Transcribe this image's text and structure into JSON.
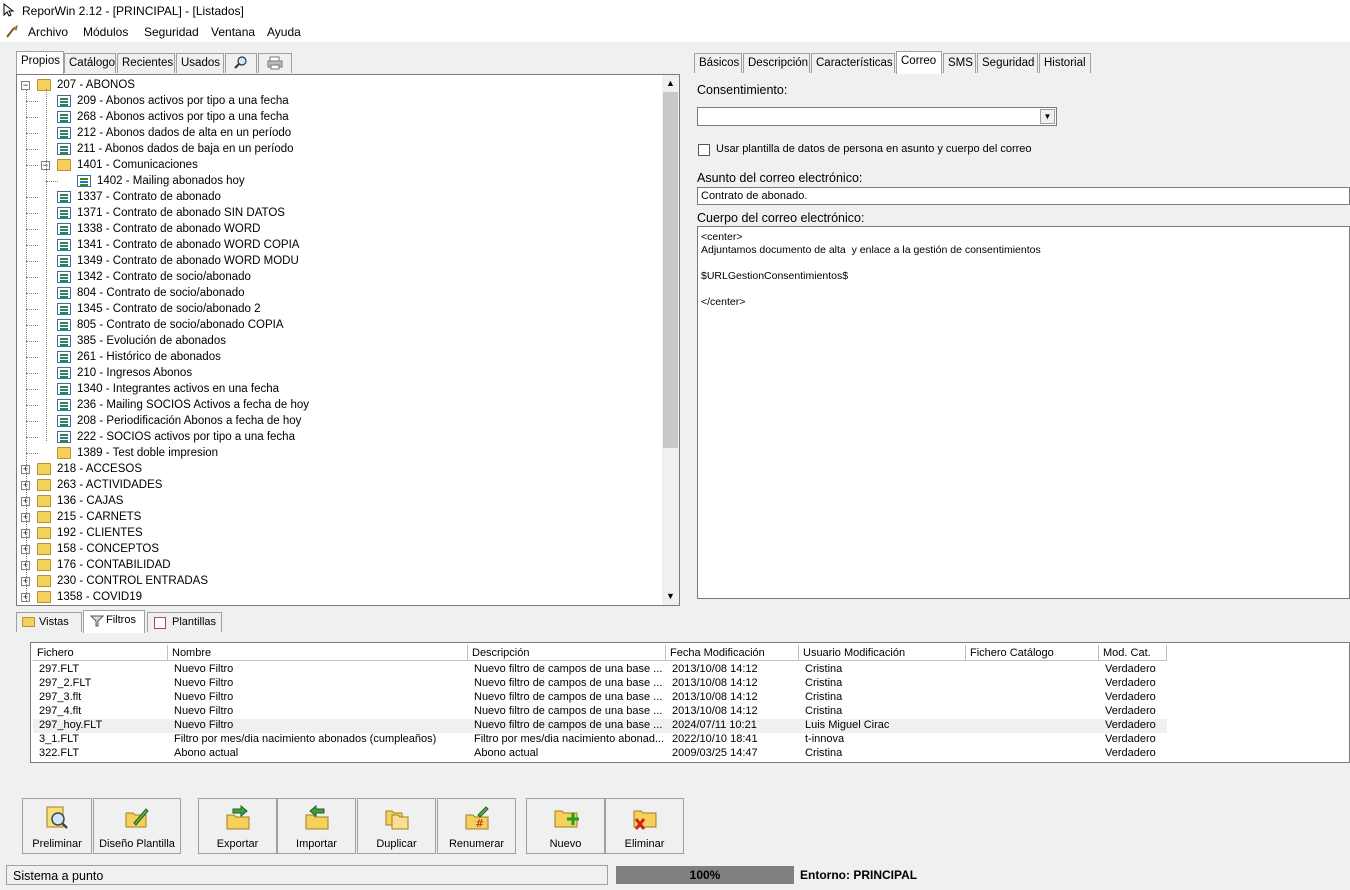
{
  "window": {
    "title": "ReporWin 2.12 - [PRINCIPAL] - [Listados]"
  },
  "menu": [
    "Archivo",
    "Módulos",
    "Seguridad",
    "Ventana",
    "Ayuda"
  ],
  "left_tabs": [
    "Propios",
    "Catálogo",
    "Recientes",
    "Usados"
  ],
  "left_tab_icons": [
    "search-icon",
    "printer-icon"
  ],
  "tree": [
    {
      "label": "207 - ABONOS",
      "level": 0,
      "type": "folder",
      "expanded": true
    },
    {
      "label": "209 - Abonos activos por tipo a una fecha",
      "level": 1,
      "type": "report"
    },
    {
      "label": "268 - Abonos activos por tipo a una fecha",
      "level": 1,
      "type": "report"
    },
    {
      "label": "212 - Abonos dados de alta en un período",
      "level": 1,
      "type": "report"
    },
    {
      "label": "211 - Abonos dados de baja en un período",
      "level": 1,
      "type": "report"
    },
    {
      "label": "1401 - Comunicaciones",
      "level": 1,
      "type": "folder",
      "expanded": true
    },
    {
      "label": "1402 - Mailing abonados hoy",
      "level": 2,
      "type": "report"
    },
    {
      "label": "1337 - Contrato de abonado",
      "level": 1,
      "type": "report"
    },
    {
      "label": "1371 - Contrato de abonado SIN DATOS",
      "level": 1,
      "type": "report"
    },
    {
      "label": "1338 - Contrato de abonado WORD",
      "level": 1,
      "type": "report"
    },
    {
      "label": "1341 - Contrato de abonado WORD COPIA",
      "level": 1,
      "type": "report"
    },
    {
      "label": "1349 - Contrato de abonado WORD MODU",
      "level": 1,
      "type": "report"
    },
    {
      "label": "1342 - Contrato de socio/abonado",
      "level": 1,
      "type": "report"
    },
    {
      "label": "804 - Contrato de socio/abonado",
      "level": 1,
      "type": "report"
    },
    {
      "label": "1345 - Contrato de socio/abonado 2",
      "level": 1,
      "type": "report"
    },
    {
      "label": "805 - Contrato de socio/abonado COPIA",
      "level": 1,
      "type": "report"
    },
    {
      "label": "385 - Evolución de abonados",
      "level": 1,
      "type": "report"
    },
    {
      "label": "261 - Histórico de abonados",
      "level": 1,
      "type": "report"
    },
    {
      "label": "210 - Ingresos Abonos",
      "level": 1,
      "type": "report"
    },
    {
      "label": "1340 - Integrantes activos en una fecha",
      "level": 1,
      "type": "report"
    },
    {
      "label": "236 - Mailing SOCIOS Activos a fecha de hoy",
      "level": 1,
      "type": "report"
    },
    {
      "label": "208 - Periodificación Abonos a fecha de hoy",
      "level": 1,
      "type": "report"
    },
    {
      "label": "222 - SOCIOS activos por tipo a una fecha",
      "level": 1,
      "type": "report"
    },
    {
      "label": "1389 - Test doble impresion",
      "level": 1,
      "type": "folder"
    },
    {
      "label": "218 - ACCESOS",
      "level": 0,
      "type": "folder"
    },
    {
      "label": "263 - ACTIVIDADES",
      "level": 0,
      "type": "folder"
    },
    {
      "label": "136 - CAJAS",
      "level": 0,
      "type": "folder"
    },
    {
      "label": "215 - CARNETS",
      "level": 0,
      "type": "folder"
    },
    {
      "label": "192 - CLIENTES",
      "level": 0,
      "type": "folder"
    },
    {
      "label": "158 - CONCEPTOS",
      "level": 0,
      "type": "folder"
    },
    {
      "label": "176 - CONTABILIDAD",
      "level": 0,
      "type": "folder"
    },
    {
      "label": "230 - CONTROL ENTRADAS",
      "level": 0,
      "type": "folder"
    },
    {
      "label": "1358 - COVID19",
      "level": 0,
      "type": "folder"
    }
  ],
  "right_tabs": [
    "Básicos",
    "Descripción",
    "Características",
    "Correo",
    "SMS",
    "Seguridad",
    "Historial"
  ],
  "correo": {
    "consent_label": "Consentimiento:",
    "consent_value": "",
    "use_template_label": "Usar plantilla de datos de persona en asunto y cuerpo del correo",
    "subject_label": "Asunto del correo electrónico:",
    "subject_value": "Contrato de abonado.",
    "body_label": "Cuerpo del correo electrónico:",
    "body_value": "<center>\nAdjuntamos documento de alta  y enlace a la gestión de consentimientos\n\n$URLGestionConsentimientos$\n\n</center>\n"
  },
  "bottom_tabs": [
    "Vistas",
    "Filtros",
    "Plantillas"
  ],
  "grid": {
    "columns": [
      "Fichero",
      "Nombre",
      "Descripción",
      "Fecha Modificación",
      "Usuario Modificación",
      "Fichero Catálogo",
      "Mod. Cat."
    ],
    "rows": [
      [
        "297.FLT",
        "Nuevo Filtro",
        "Nuevo filtro de campos de una base ...",
        "2013/10/08 14:12",
        "Cristina",
        "",
        "Verdadero"
      ],
      [
        "297_2.FLT",
        "Nuevo Filtro",
        "Nuevo filtro de campos de una base ...",
        "2013/10/08 14:12",
        "Cristina",
        "",
        "Verdadero"
      ],
      [
        "297_3.flt",
        "Nuevo Filtro",
        "Nuevo filtro de campos de una base ...",
        "2013/10/08 14:12",
        "Cristina",
        "",
        "Verdadero"
      ],
      [
        "297_4.flt",
        "Nuevo Filtro",
        "Nuevo filtro de campos de una base ...",
        "2013/10/08 14:12",
        "Cristina",
        "",
        "Verdadero"
      ],
      [
        "297_hoy.FLT",
        "Nuevo Filtro",
        "Nuevo filtro de campos de una base ...",
        "2024/07/11 10:21",
        "Luis Miguel Cirac",
        "",
        "Verdadero"
      ],
      [
        "3_1.FLT",
        "Filtro por mes/dia nacimiento abonados (cumpleaños)",
        "Filtro por mes/dia nacimiento abonad...",
        "2022/10/10 18:41",
        "t-innova",
        "",
        "Verdadero"
      ],
      [
        "322.FLT",
        "Abono actual",
        "Abono actual",
        "2009/03/25 14:47",
        "Cristina",
        "",
        "Verdadero"
      ]
    ]
  },
  "toolbar": [
    {
      "label": "Preliminar",
      "icon": "preview-icon"
    },
    {
      "label": "Diseño Plantilla",
      "icon": "design-template-icon"
    },
    {
      "label": "Exportar",
      "icon": "export-icon"
    },
    {
      "label": "Importar",
      "icon": "import-icon"
    },
    {
      "label": "Duplicar",
      "icon": "duplicate-icon"
    },
    {
      "label": "Renumerar",
      "icon": "renumber-icon"
    },
    {
      "label": "Nuevo",
      "icon": "new-icon"
    },
    {
      "label": "Eliminar",
      "icon": "delete-icon"
    }
  ],
  "status": {
    "message": "Sistema a punto",
    "progress": "100%",
    "progress_fraction": 1.0,
    "env_label": "Entorno:",
    "env_value": "PRINCIPAL"
  },
  "colors": {
    "folder": "#f5d05a",
    "progress": "#808080"
  }
}
